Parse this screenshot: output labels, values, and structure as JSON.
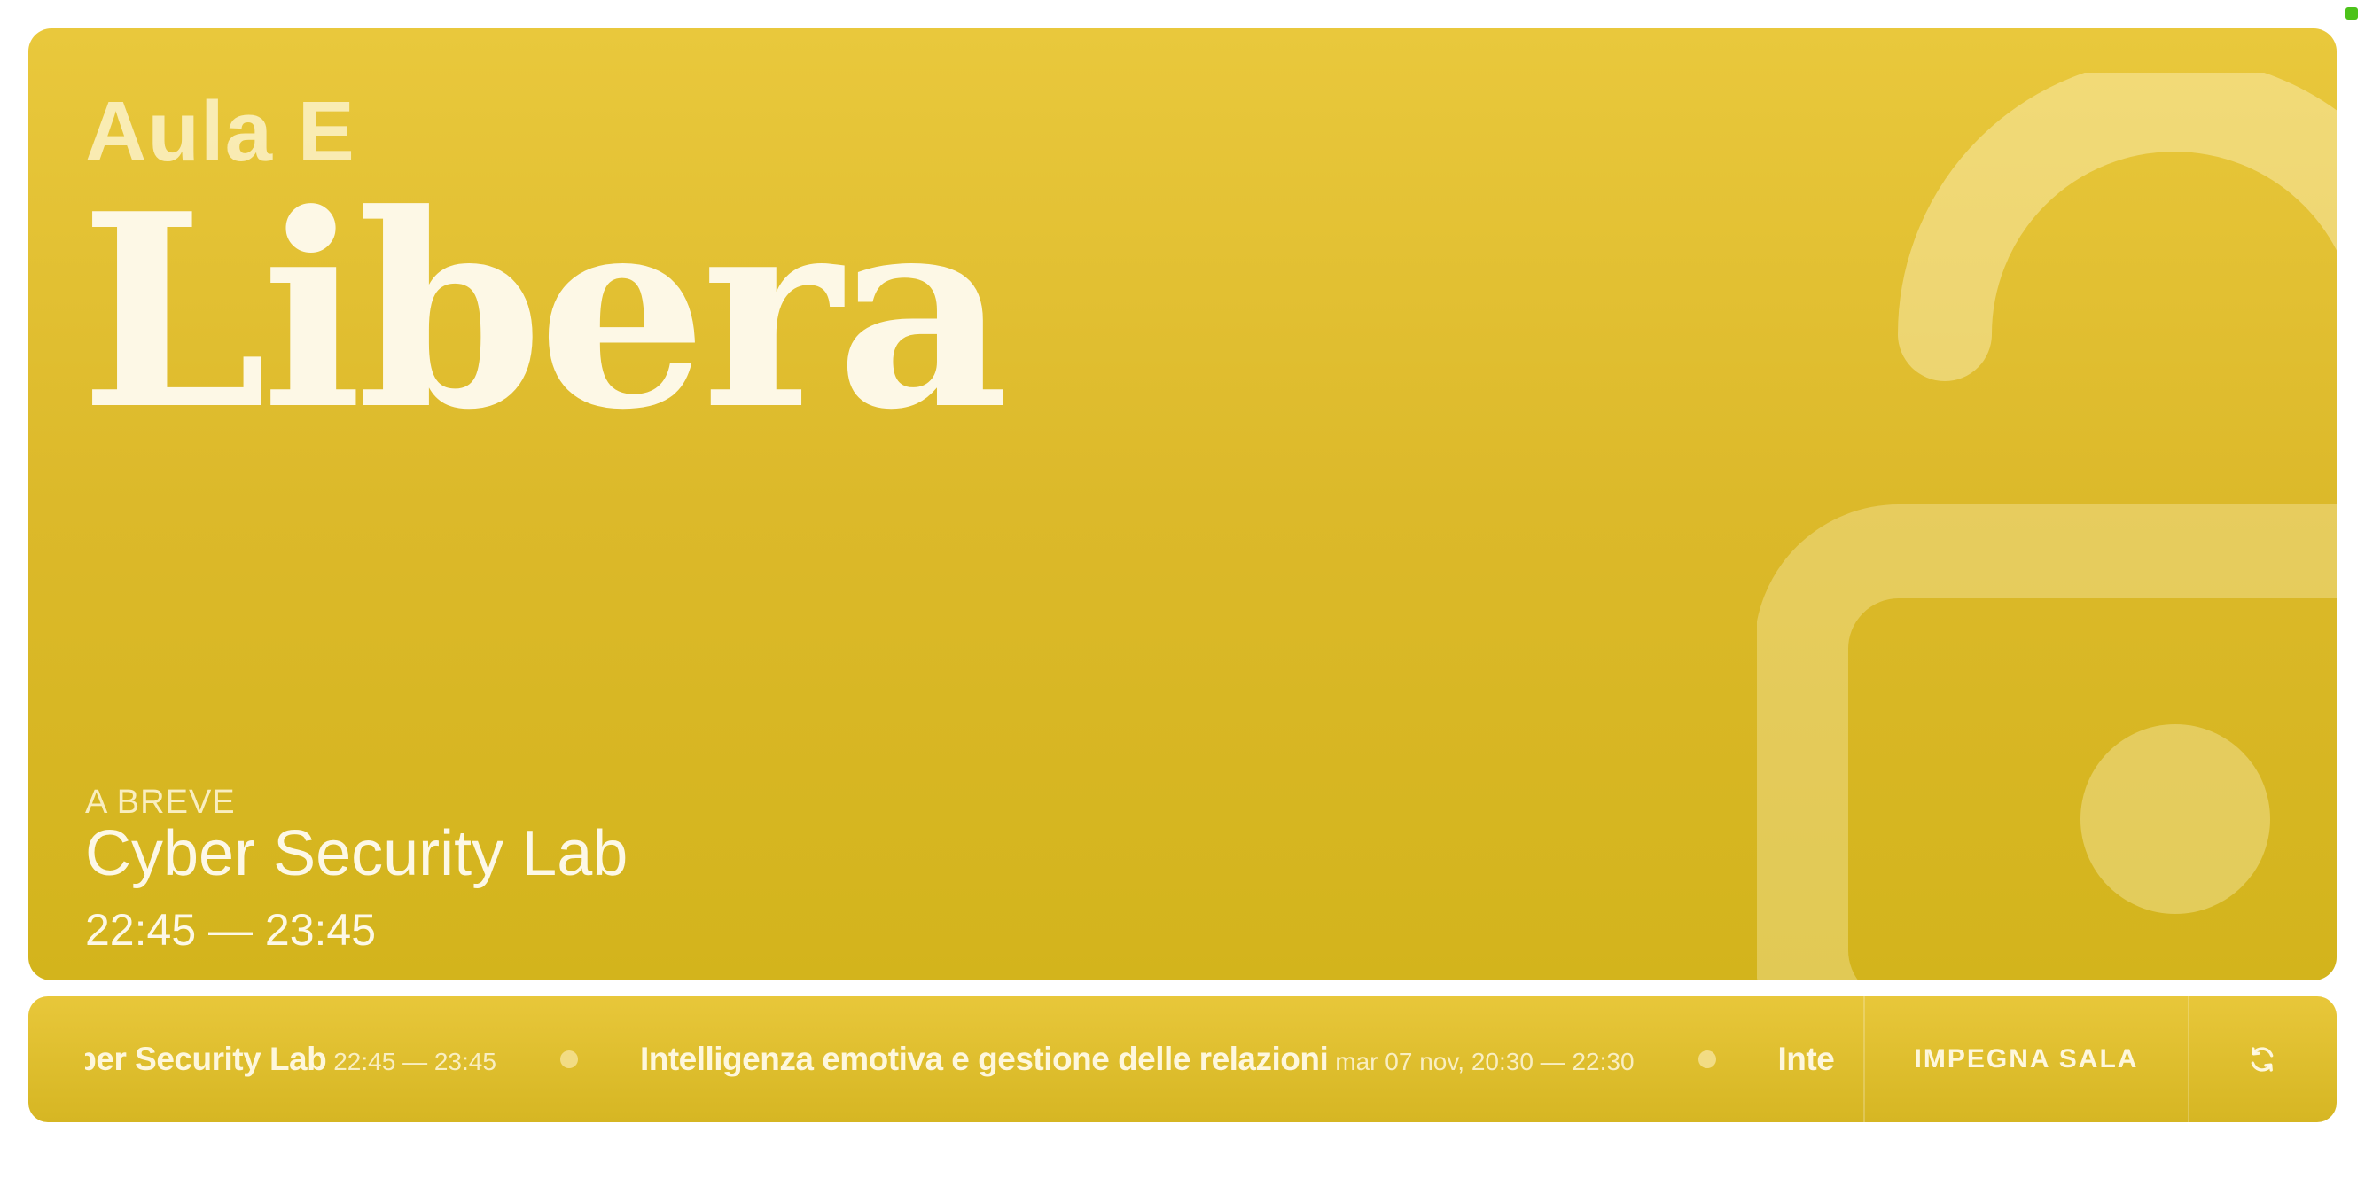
{
  "room": {
    "name": "Aula E",
    "status": "Libera"
  },
  "next_event": {
    "label": "A BREVE",
    "title": "Cyber Security Lab",
    "time": "22:45 — 23:45"
  },
  "ticker": {
    "items": [
      {
        "title": "Cyber Security Lab",
        "time": "22:45 — 23:45"
      },
      {
        "title": "Intelligenza emotiva e gestione delle relazioni",
        "time": "mar 07 nov, 20:30 — 22:30"
      },
      {
        "title": "Intelligenza emotiva e gestione delle relazioni",
        "time": ""
      }
    ]
  },
  "actions": {
    "book_label": "IMPEGNA SALA",
    "refresh_icon": "refresh-icon"
  },
  "icons": {
    "background": "unlocked-padlock-icon",
    "status_indicator": "online-status-indicator"
  },
  "colors": {
    "panel_top": "#e9c83c",
    "panel_bottom": "#d3b41c",
    "text": "#fdf8e6",
    "status_indicator": "#4cc21a"
  }
}
